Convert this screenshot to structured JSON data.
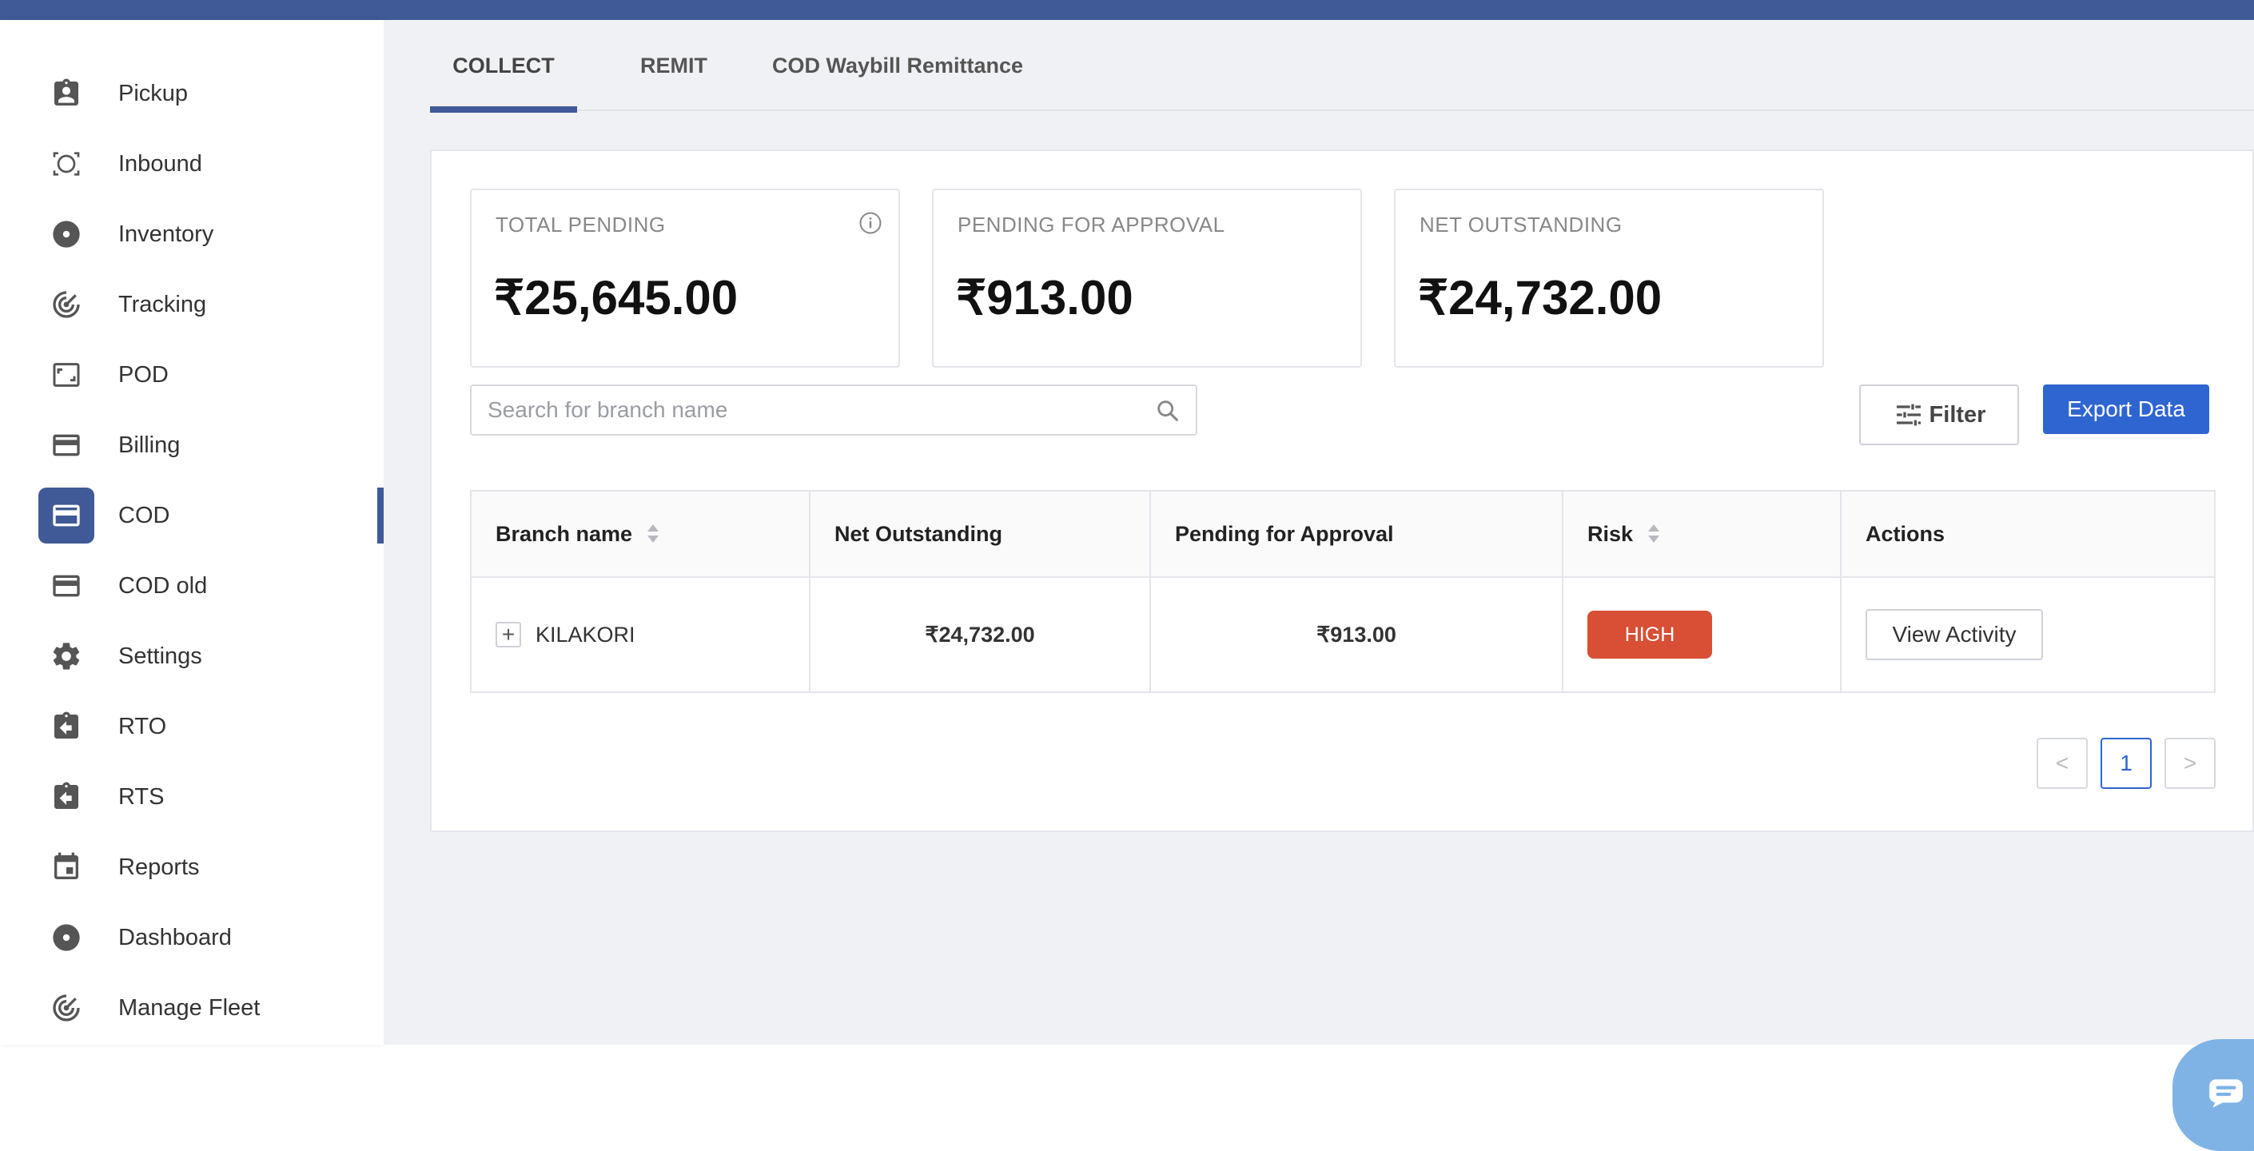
{
  "sidebar": {
    "items": [
      {
        "label": "Pickup",
        "icon": "clipboard-user-icon"
      },
      {
        "label": "Inbound",
        "icon": "scan-frame-icon"
      },
      {
        "label": "Inventory",
        "icon": "disc-icon"
      },
      {
        "label": "Tracking",
        "icon": "radar-icon"
      },
      {
        "label": "POD",
        "icon": "photo-frame-icon"
      },
      {
        "label": "Billing",
        "icon": "credit-card-icon"
      },
      {
        "label": "COD",
        "icon": "credit-card-icon",
        "active": true
      },
      {
        "label": "COD old",
        "icon": "credit-card-icon"
      },
      {
        "label": "Settings",
        "icon": "gear-icon"
      },
      {
        "label": "RTO",
        "icon": "clipboard-return-icon"
      },
      {
        "label": "RTS",
        "icon": "clipboard-return-icon"
      },
      {
        "label": "Reports",
        "icon": "calendar-icon"
      },
      {
        "label": "Dashboard",
        "icon": "disc-icon"
      },
      {
        "label": "Manage Fleet",
        "icon": "radar-icon"
      }
    ]
  },
  "tabs": [
    {
      "label": "COLLECT",
      "active": true
    },
    {
      "label": "REMIT"
    },
    {
      "label": "COD Waybill Remittance"
    }
  ],
  "stats": {
    "total_pending": {
      "title": "TOTAL PENDING",
      "value": "₹25,645.00"
    },
    "pending_approval": {
      "title": "PENDING FOR APPROVAL",
      "value": "₹913.00"
    },
    "net_outstanding": {
      "title": "NET OUTSTANDING",
      "value": "₹24,732.00"
    }
  },
  "search": {
    "placeholder": "Search for branch name",
    "value": ""
  },
  "toolbar": {
    "filter_label": "Filter",
    "export_label": "Export Data"
  },
  "table": {
    "headers": [
      "Branch name",
      "Net Outstanding",
      "Pending for Approval",
      "Risk",
      "Actions"
    ],
    "rows": [
      {
        "branch": "KILAKORI",
        "net_outstanding": "₹24,732.00",
        "pending_approval": "₹913.00",
        "risk": "HIGH",
        "action": "View Activity",
        "expand": "+"
      }
    ]
  },
  "pagination": {
    "prev": "<",
    "current": "1",
    "next": ">"
  },
  "colors": {
    "brand": "#3f5a96",
    "primary_button": "#2f65d1",
    "risk_high": "#d84f35",
    "chat": "#7fb3e6"
  }
}
